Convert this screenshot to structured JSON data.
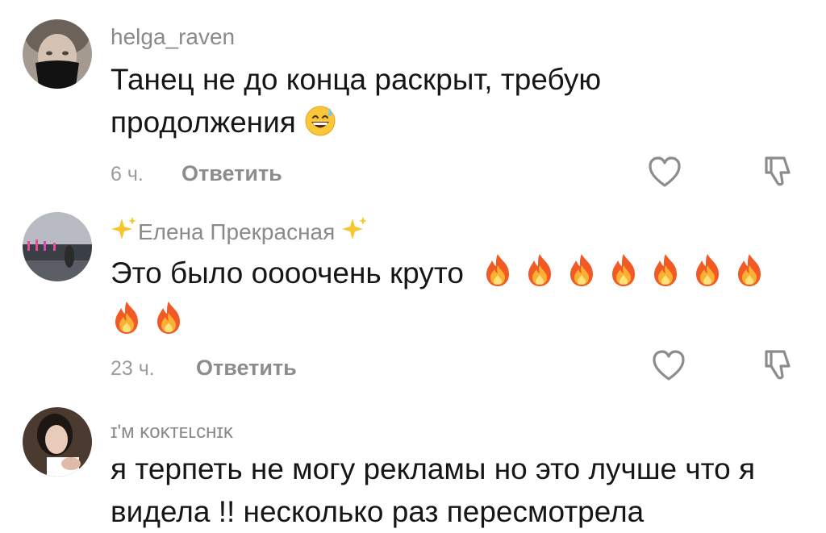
{
  "comments": [
    {
      "username": "helga_raven",
      "text": "Танец не до конца раскрыт, требую продолжения",
      "emoji": "sweat-smile-emoji",
      "time": "6 ч.",
      "reply_label": "Ответить"
    },
    {
      "username": "Елена Прекрасная",
      "username_decoration": "sparkles-emoji",
      "text": "Это было оооочень круто",
      "emoji": "fire-emoji",
      "emoji_count": 9,
      "time": "23 ч.",
      "reply_label": "Ответить"
    },
    {
      "username": "ɪ'м ᴋᴏᴋᴛᴇʟᴄʜɪᴋ",
      "text_line1": "я терпеть не могу рекламы но это лучше что я",
      "text_line2": "видела !! несколько раз пересмотрела"
    }
  ],
  "icons": {
    "like": "heart-outline-icon",
    "dislike": "thumbs-down-outline-icon"
  },
  "colors": {
    "text": "#161616",
    "muted": "#8a8a8a",
    "icon": "#8c8c8c"
  }
}
